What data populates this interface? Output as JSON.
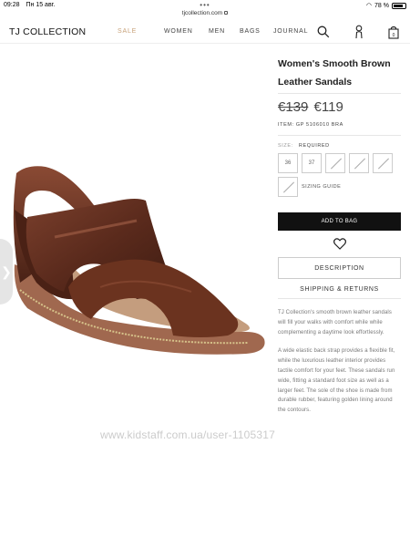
{
  "status_bar": {
    "time": "09:28",
    "date": "Пн 15 авг.",
    "battery": "78 %"
  },
  "browser": {
    "url": "tjcollection.com"
  },
  "header": {
    "logo": "TJ COLLECTION",
    "nav": [
      "SALE",
      "WOMEN",
      "MEN",
      "BAGS",
      "JOURNAL"
    ],
    "sale_color": "#c8a27a"
  },
  "product": {
    "title_line1": "Women's Smooth Brown",
    "title_line2": "Leather Sandals",
    "old_price": "€139",
    "price": "€119",
    "item_label": "ITEM:",
    "item_code": "GP 5106010 BRA",
    "size_label": "SIZE:",
    "size_required": "REQUIRED",
    "sizes": [
      "36",
      "37"
    ],
    "sizing_guide": "SIZING GUIDE",
    "add_to_bag": "ADD TO BAG",
    "description_button": "DESCRIPTION",
    "shipping": "SHIPPING & RETURNS",
    "description_1": "TJ Collection's smooth brown leather sandals will fill your walks with comfort while  while complementing a daytime look effortlessly.",
    "description_2": "A wide elastic back strap provides a flexible fit, while the luxurious leather interior provides tactile comfort for your feet. These sandals run wide, fitting a standard foot size as well as a larger feet. The sole of the shoe is made from durable rubber, featuring golden lining around the contours."
  },
  "watermark": "www.kidstaff.com.ua/user-1105317"
}
